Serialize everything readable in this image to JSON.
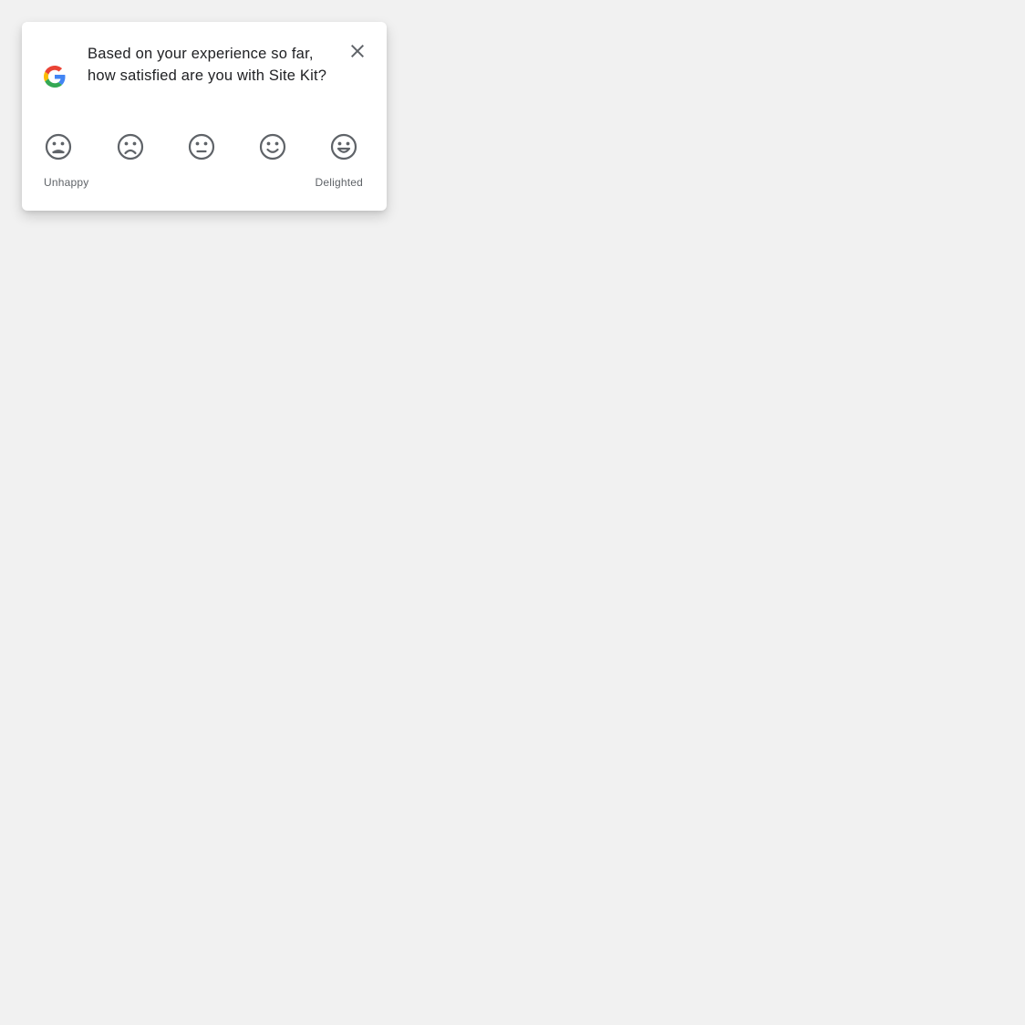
{
  "survey": {
    "question": "Based on your experience so far, how satisfied are you with Site Kit?",
    "close_icon": "close-icon",
    "logo_icon": "google-g-logo",
    "ratings": [
      {
        "icon": "very-unhappy-face-icon"
      },
      {
        "icon": "unhappy-face-icon"
      },
      {
        "icon": "neutral-face-icon"
      },
      {
        "icon": "happy-face-icon"
      },
      {
        "icon": "delighted-face-icon"
      }
    ],
    "label_low": "Unhappy",
    "label_high": "Delighted"
  },
  "colors": {
    "background": "#f1f1f1",
    "card": "#ffffff",
    "text": "#202124",
    "secondary_text": "#5f6368",
    "icon": "#5f6368",
    "google_blue": "#4285F4",
    "google_red": "#EA4335",
    "google_yellow": "#FBBC05",
    "google_green": "#34A853"
  }
}
